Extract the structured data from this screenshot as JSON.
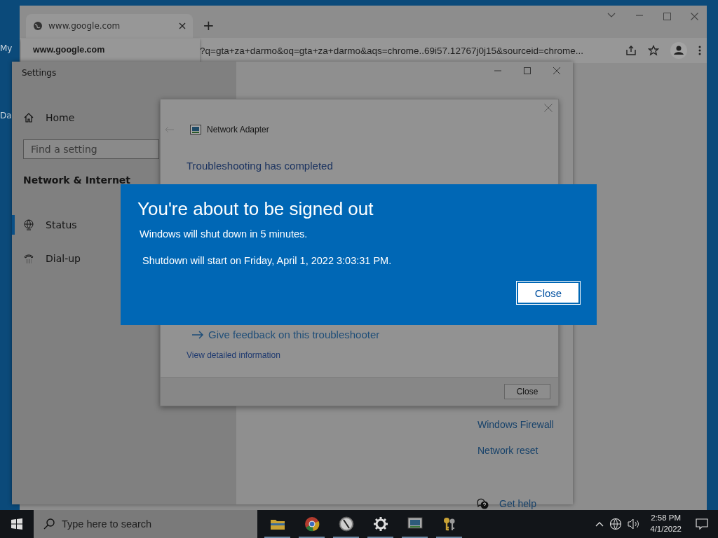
{
  "desktop": {
    "icon_labels": [
      "My",
      "Da"
    ]
  },
  "browser": {
    "tabs": [
      {
        "title": "www.google.com",
        "selected": true
      }
    ],
    "new_tab": "+",
    "tab_tooltip": "www.google.com",
    "address": "?q=gta+za+darmo&oq=gta+za+darmo&aqs=chrome..69i57.12767j0j15&sourceid=chrome..."
  },
  "settings": {
    "title": "Settings",
    "home": "Home",
    "search": {
      "placeholder": "Find a setting"
    },
    "section": "Network & Internet",
    "items": [
      {
        "label": "Status",
        "kind": "globe",
        "selected": true
      },
      {
        "label": "Dial-up",
        "kind": "phone",
        "selected": false
      }
    ],
    "links": [
      "Windows Firewall",
      "Network reset"
    ],
    "help": "Get help"
  },
  "troubleshooter": {
    "title": "Network Adapter",
    "heading": "Troubleshooting has completed",
    "feedback_link": "Give feedback on this troubleshooter",
    "details_link": "View detailed information",
    "button": "Close"
  },
  "signout_dialog": {
    "title": "You're about to be signed out",
    "message": "Windows will shut down in 5 minutes.",
    "detail": "Shutdown will start on Friday, April 1, 2022 3:03:31 PM.",
    "button": "Close"
  },
  "taskbar": {
    "search": {
      "placeholder": "Type here to search"
    },
    "apps": [
      {
        "kind": "folder",
        "running": true
      },
      {
        "kind": "chrome",
        "running": true
      },
      {
        "kind": "compass",
        "running": true
      },
      {
        "kind": "gear",
        "running": true
      },
      {
        "kind": "monitor",
        "running": true
      },
      {
        "kind": "keys",
        "running": true
      }
    ],
    "time": "2:58 PM",
    "date": "4/1/2022"
  }
}
